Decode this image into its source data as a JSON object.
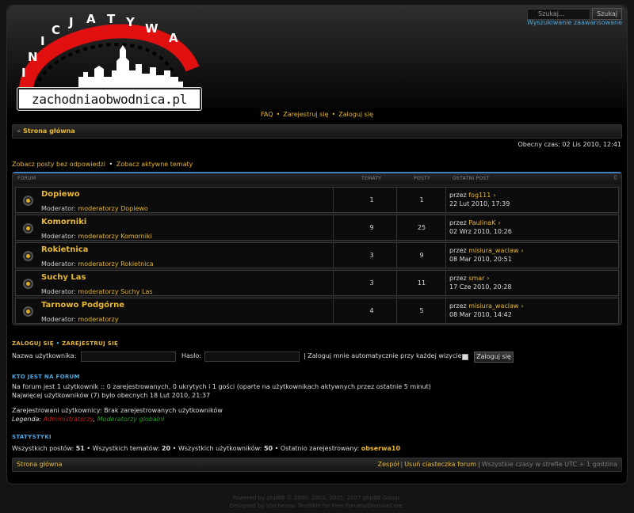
{
  "header": {
    "logo_alt_top": "INICJATYWA",
    "logo_domain": "zachodniaobwodnica.pl",
    "search_placeholder": "Szukaj...",
    "search_button": "Szukaj",
    "advanced_search": "Wyszukiwanie zaawansowane"
  },
  "nav": {
    "faq": "FAQ",
    "register": "Zarejestruj się",
    "login": "Zaloguj się"
  },
  "breadcrumb": {
    "home": "Strona główna"
  },
  "current_time": "Obecny czas: 02 Lis 2010, 12:41",
  "quick_links": {
    "unanswered": "Zobacz posty bez odpowiedzi",
    "active": "Zobacz aktywne tematy"
  },
  "forum_table": {
    "headers": {
      "forum": "FORUM",
      "topics": "TEMATY",
      "posts": "POSTY",
      "last_post": "OSTATNI POST"
    },
    "moderator_label": "Moderator:",
    "by_label": "przez",
    "rows": [
      {
        "name": "Dopiewo",
        "moderator": "moderatorzy Dopiewo",
        "topics": "1",
        "posts": "1",
        "last_user": "fog111",
        "last_date": "22 Lut 2010, 17:39"
      },
      {
        "name": "Komorniki",
        "moderator": "moderatorzy Komorniki",
        "topics": "9",
        "posts": "25",
        "last_user": "PaulinaK",
        "last_date": "02 Wrz 2010, 10:26"
      },
      {
        "name": "Rokietnica",
        "moderator": "moderatorzy Rokietnica",
        "topics": "3",
        "posts": "9",
        "last_user": "misiura_waclaw",
        "last_date": "08 Mar 2010, 20:51"
      },
      {
        "name": "Suchy Las",
        "moderator": "moderatorzy Suchy Las",
        "topics": "3",
        "posts": "11",
        "last_user": "smar",
        "last_date": "17 Cze 2010, 20:28"
      },
      {
        "name": "Tarnowo Podgórne",
        "moderator": "moderatorzy",
        "topics": "4",
        "posts": "5",
        "last_user": "misiura_waclaw",
        "last_date": "08 Mar 2010, 14:42"
      }
    ]
  },
  "login": {
    "title_login": "ZALOGUJ SIĘ",
    "title_sep": "•",
    "title_register": "ZAREJESTRUJ SIĘ",
    "username_label": "Nazwa użytkownika:",
    "password_label": "Hasło:",
    "autologin_label": "| Zaloguj mnie automatycznie przy każdej wizycie",
    "button": "Zaloguj się"
  },
  "whois": {
    "title": "KTO JEST NA FORUM",
    "line1": "Na forum jest 1 użytkownik :: 0 zarejestrowanych, 0 ukrytych i 1 gości (oparte na użytkownikach aktywnych przez ostatnie 5 minut)",
    "line2": "Najwięcej użytkowników (7) było obecnych 18 Lut 2010, 21:37",
    "line3": "Zarejestrowani użytkownicy: Brak zarejestrowanych użytkowników",
    "legend_label": "Legenda:",
    "legend_admin": "Administratorzy",
    "legend_global": "Moderatorzy globalni"
  },
  "stats": {
    "title": "STATYSTYKI",
    "posts_label": "Wszystkich postów:",
    "posts": "51",
    "topics_label": "Wszystkich tematów:",
    "topics": "20",
    "users_label": "Wszystkich użytkowników:",
    "users": "50",
    "newest_label": "Ostatnio zarejestrowany:",
    "newest": "obserwa10"
  },
  "footer": {
    "home": "Strona główna",
    "team": "Zespół",
    "delete_cookies": "Usuń ciasteczka forum",
    "timezone": "Wszystkie czasy w strefie UTC + 1 godzina"
  },
  "credits": {
    "line1": "Powered by phpBB © 2000, 2002, 2005, 2007 phpBB Group.",
    "line2": "Designed by Vjacheslav Trushkin for Free Forums/DivisionCore."
  }
}
